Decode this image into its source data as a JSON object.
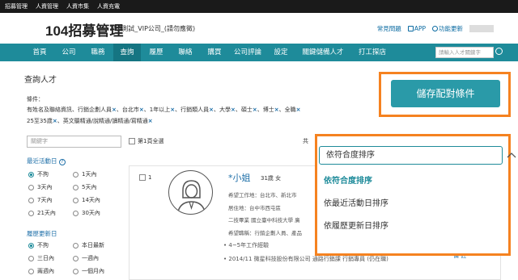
{
  "topbar": [
    "招募管理",
    "人資管理",
    "人資市集",
    "人資充電"
  ],
  "header": {
    "logo_num": "104",
    "logo_text": "招募管理",
    "company": "104測試_VIP公司_(請勿應徵)",
    "faq": "常見問題",
    "app": "APP",
    "features": "功能更新"
  },
  "nav": {
    "items": [
      "首頁",
      "公司",
      "職務",
      "查詢",
      "履歷",
      "聯絡",
      "購買",
      "公司評論",
      "設定",
      "關鍵儲備人才",
      "打工探店"
    ],
    "active_index": 3,
    "search_placeholder": "請輸入人才關鍵字"
  },
  "page_title": "查詢人才",
  "conditions": {
    "label": "條件：",
    "line1": [
      {
        "text": "有姓名及聯絡資訊、行銷企劃人員",
        "x": true
      },
      {
        "text": "、台北市",
        "x": true
      },
      {
        "text": "、1年以上",
        "x": true
      },
      {
        "text": "、行銷類人員",
        "x": true
      },
      {
        "text": "、大學",
        "x": true
      },
      {
        "text": "、碩士",
        "x": true
      },
      {
        "text": "、博士",
        "x": true
      },
      {
        "text": "、全職",
        "x": true
      }
    ],
    "line2": [
      {
        "text": "25至35歲",
        "x": true
      },
      {
        "text": "、英文聽精通/說精通/讀精通/寫精通",
        "x": true
      }
    ]
  },
  "keyword_placeholder": "關鍵字",
  "select_all": "第1頁全選",
  "gong": "共",
  "sidebar": {
    "activity_title": "最近活動日",
    "activity": [
      "不拘",
      "1天內",
      "3天內",
      "5天內",
      "7天內",
      "14天內",
      "21天內",
      "30天內"
    ],
    "activity_selected": 0,
    "update_title": "履歷更新日",
    "update": [
      "不拘",
      "本日最新",
      "三日內",
      "一週內",
      "兩週內",
      "一個月內"
    ],
    "update_selected": 0
  },
  "candidate": {
    "index": "1",
    "name": "*小姐",
    "age_gender": "31歲  女",
    "lines": [
      "希望工作地：台北市、新北市",
      "居住地：台中市西屯區",
      "二技畢業 國立臺中科技大學 廣",
      "希望職稱：行銷企劃人員、產品"
    ],
    "bullets": [
      "4~5年工作經驗",
      "2014/11 微星科技股份有限公司 通路行銷課 行銷專員 (仍在職)"
    ],
    "actions": "備    註"
  },
  "save_button": "儲存配對條件",
  "sort": {
    "current": "依符合度排序",
    "options": [
      "依符合度排序",
      "依最近活動日排序",
      "依履歷更新日排序"
    ],
    "selected": 0
  }
}
